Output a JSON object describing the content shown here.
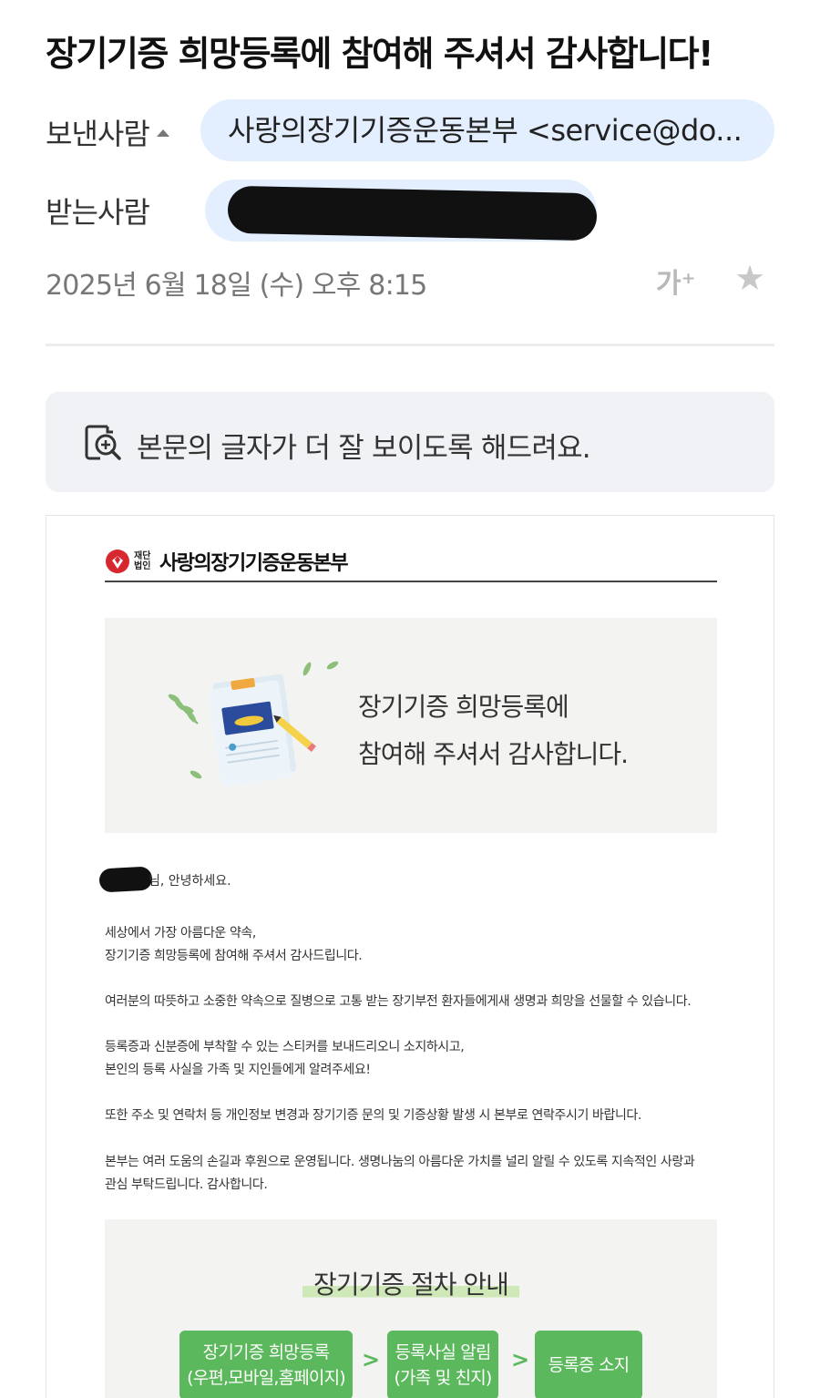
{
  "email": {
    "subject": "장기기증 희망등록에 참여해 주셔서 감사합니다!",
    "sender_label": "보낸사람",
    "sender_value": "사랑의장기기증운동본부 <service@do...",
    "recipient_label": "받는사람",
    "date": "2025년 6월 18일 (수) 오후 8:15",
    "font_size_button": "가⁺",
    "readable_prompt": "본문의 글자가 더 잘 보이도록 해드려요."
  },
  "body": {
    "logo_small": "재단 법인",
    "logo_text": "사랑의장기기증운동본부",
    "banner_line1": "장기기증 희망등록에",
    "banner_line2": "참여해 주셔서 감사합니다.",
    "greeting": "님, 안녕하세요.",
    "para1_line1": "세상에서 가장 아름다운 약속,",
    "para1_line2": "장기기증 희망등록에 참여해 주셔서 감사드립니다.",
    "para2": "여러분의 따뜻하고 소중한 약속으로 질병으로 고통 받는 장기부전 환자들에게새 생명과 희망을 선물할 수 있습니다.",
    "para3_line1": "등록증과 신분증에 부착할 수 있는 스티커를 보내드리오니 소지하시고,",
    "para3_line2": "본인의 등록 사실을 가족 및 지인들에게 알려주세요!",
    "para4": "또한 주소 및 연락처 등 개인정보 변경과 장기기증 문의 및 기증상황 발생 시 본부로 연락주시기 바랍니다.",
    "para5_line1": "본부는 여러 도움의 손길과 후원으로 운영됩니다. 생명나눔의 아름다운 가치를 널리 알릴 수 있도록 지속적인 사랑과",
    "para5_line2": "관심 부탁드립니다. 감사합니다."
  },
  "procedure": {
    "title": "장기기증 절차 안내",
    "step1_line1": "장기기증 희망등록",
    "step1_line2": "(우편,모바일,홈페이지)",
    "step2_line1": "등록사실 알림",
    "step2_line2": "(가족 및 친지)",
    "step3": "등록증 소지",
    "arrow": ">"
  },
  "colors": {
    "pill_bg": "#e3efff",
    "step_green": "#5cb85c",
    "logo_red": "#d7282f"
  }
}
